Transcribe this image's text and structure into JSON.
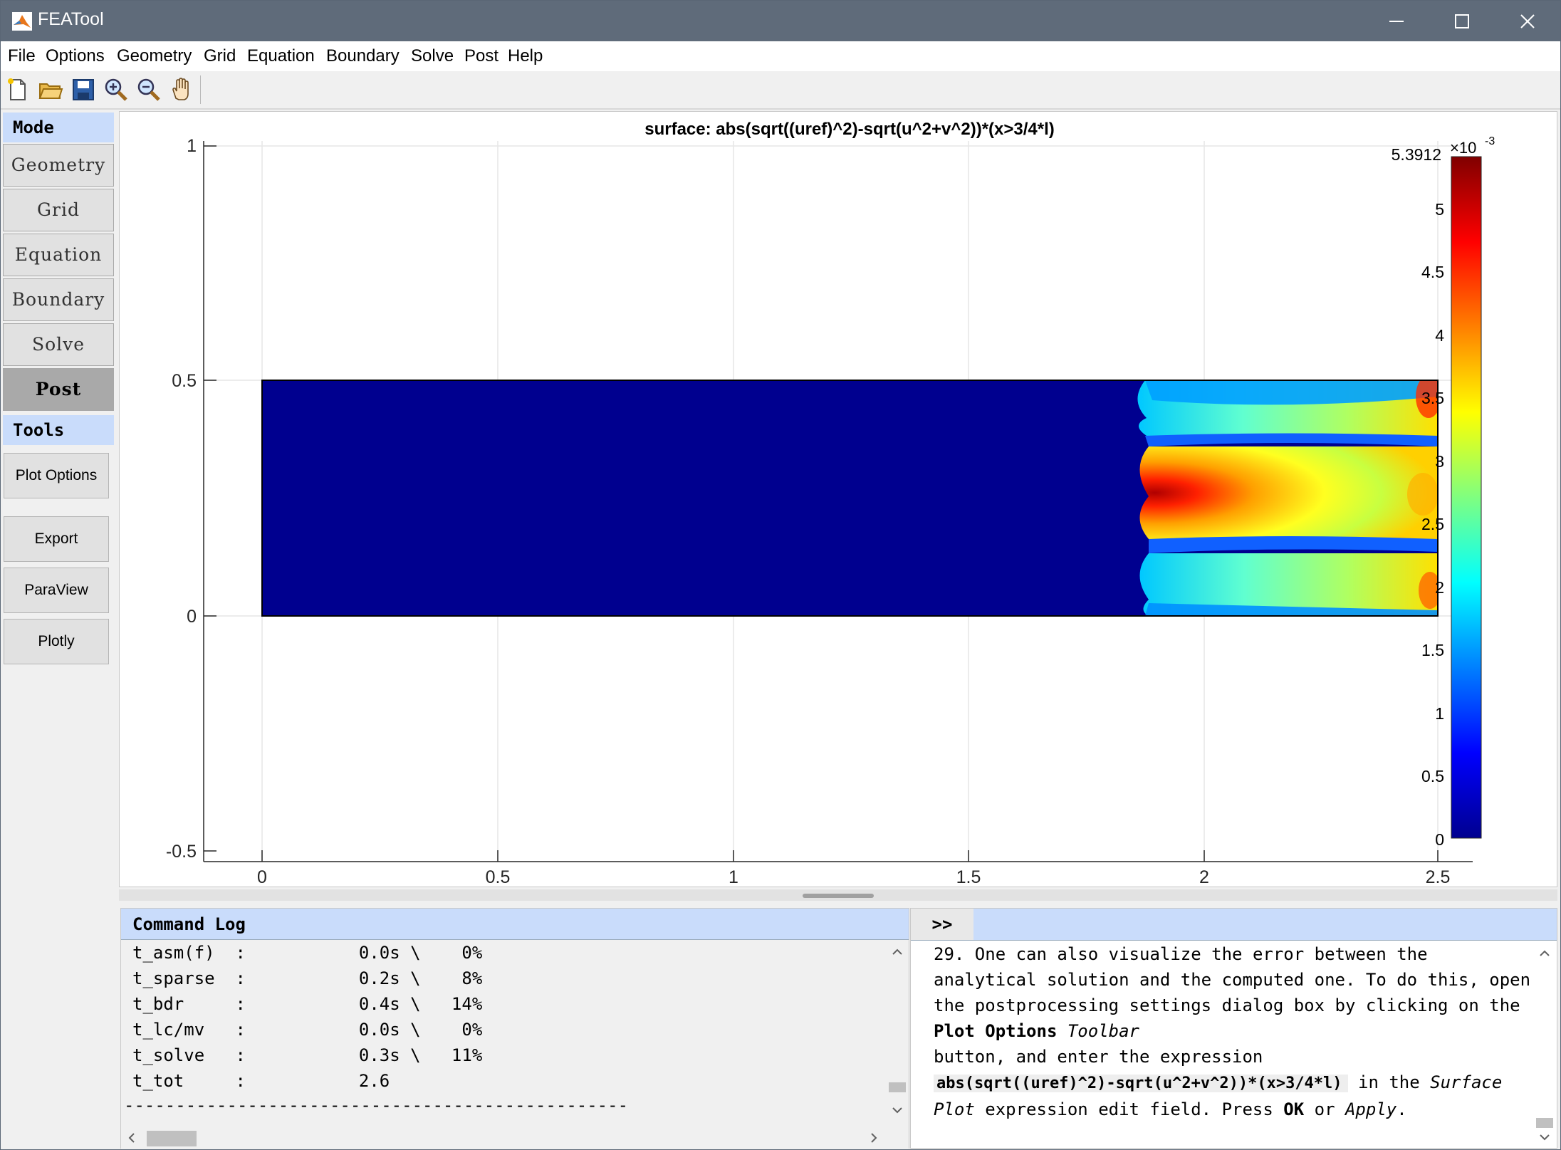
{
  "window": {
    "title": "FEATool"
  },
  "menu": [
    "File",
    "Options",
    "Geometry",
    "Grid",
    "Equation",
    "Boundary",
    "Solve",
    "Post",
    "Help"
  ],
  "toolbar": {
    "buttons": [
      {
        "name": "new-file-icon",
        "tooltip": "New"
      },
      {
        "name": "open-folder-icon",
        "tooltip": "Open"
      },
      {
        "name": "save-disk-icon",
        "tooltip": "Save"
      },
      {
        "name": "zoom-in-icon",
        "tooltip": "Zoom in"
      },
      {
        "name": "zoom-out-icon",
        "tooltip": "Zoom out"
      },
      {
        "name": "pan-hand-icon",
        "tooltip": "Pan"
      }
    ]
  },
  "sidebar": {
    "mode_header": "Mode",
    "modes": [
      "Geometry",
      "Grid",
      "Equation",
      "Boundary",
      "Solve",
      "Post"
    ],
    "active_mode": "Post",
    "tools_header": "Tools",
    "tools": [
      "Plot Options",
      "Export",
      "ParaView",
      "Plotly"
    ]
  },
  "plot": {
    "title": "surface: abs(sqrt((uref)^2)-sqrt(u^2+v^2))*(x>3/4*l)",
    "x_ticks": [
      "0",
      "0.5",
      "1",
      "1.5",
      "2",
      "2.5"
    ],
    "y_ticks": [
      "1",
      "0.5",
      "0",
      "-0.5"
    ],
    "colorbar": {
      "max_label": "5.3912",
      "exponent_base": "×10",
      "exponent": "-3",
      "ticks": [
        "5",
        "4.5",
        "4",
        "3.5",
        "3",
        "2.5",
        "2",
        "1.5",
        "1",
        "0.5",
        "0"
      ],
      "colormap": "jet"
    },
    "colors": {
      "low": "#00008f",
      "grid": "#e6e6e6"
    }
  },
  "chart_data": {
    "type": "heatmap",
    "title": "surface: abs(sqrt((uref)^2)-sqrt(u^2+v^2))*(x>3/4*l)",
    "xlim": [
      -0.25,
      2.5
    ],
    "ylim": [
      -0.5,
      1
    ],
    "domain": {
      "x": [
        0,
        2.5
      ],
      "y": [
        0,
        0.5
      ]
    },
    "colorbar_range": [
      0,
      0.0053912
    ],
    "description_values": {
      "zero_region_x": [
        0,
        1.875
      ],
      "max_value": 0.0053912,
      "max_location_x": 1.9
    }
  },
  "log": {
    "header": "Command Log",
    "lines": [
      "t_asm(f)  :           0.0s \\    0%",
      "t_sparse  :           0.2s \\    8%",
      "t_bdr     :           0.4s \\   14%",
      "t_lc/mv   :           0.0s \\    0%",
      "t_solve   :           0.3s \\   11%",
      "t_tot     :           2.6",
      "-------------------------------------------------"
    ]
  },
  "help": {
    "expand_label": ">>",
    "step": "29.",
    "t1": " One can also visualize the error between the analytical solution and the computed one. To do this, open the postprocessing settings dialog box by clicking on the ",
    "b1": "Plot Options",
    "i1": "Toolbar",
    "t2": "button, and enter the expression",
    "code": "abs(sqrt((uref)^2)-sqrt(u^2+v^2))*(x>3/4*l)",
    "t3": " in the ",
    "i2": "Surface Plot",
    "t4": " expression edit field. Press ",
    "b2": "OK",
    "t5": " or ",
    "i3": "Apply",
    "t6": "."
  }
}
